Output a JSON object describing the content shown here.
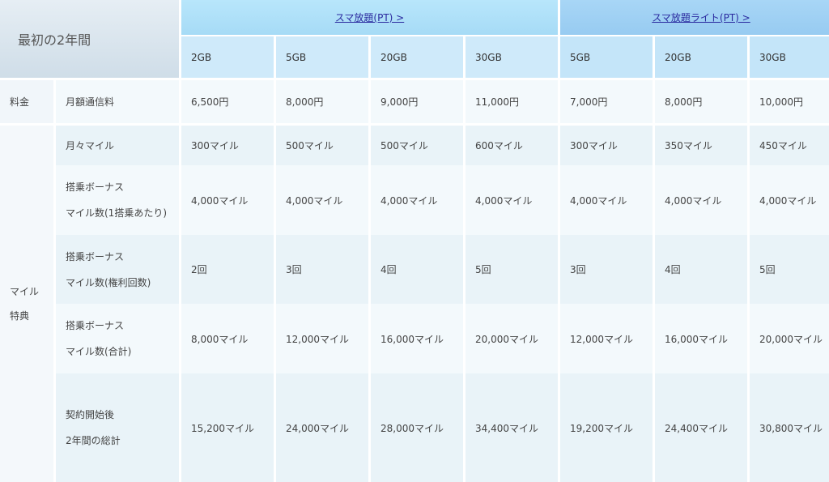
{
  "header": {
    "corner": "最初の2年間",
    "groups": [
      {
        "label": "スマ放題(PT) >"
      },
      {
        "label": "スマ放題ライト(PT) >"
      }
    ],
    "plans": [
      "2GB",
      "5GB",
      "20GB",
      "30GB",
      "5GB",
      "20GB",
      "30GB"
    ]
  },
  "sections": [
    {
      "label": "料金"
    },
    {
      "label": "マイル\n特典"
    }
  ],
  "rows": [
    {
      "label": "月額通信料",
      "values": [
        "6,500円",
        "8,000円",
        "9,000円",
        "11,000円",
        "7,000円",
        "8,000円",
        "10,000円"
      ]
    },
    {
      "label": "月々マイル",
      "values": [
        "300マイル",
        "500マイル",
        "500マイル",
        "600マイル",
        "300マイル",
        "350マイル",
        "450マイル"
      ]
    },
    {
      "label": "搭乗ボーナス\nマイル数(1搭乗あたり)",
      "values": [
        "4,000マイル",
        "4,000マイル",
        "4,000マイル",
        "4,000マイル",
        "4,000マイル",
        "4,000マイル",
        "4,000マイル"
      ]
    },
    {
      "label": "搭乗ボーナス\nマイル数(権利回数)",
      "values": [
        "2回",
        "3回",
        "4回",
        "5回",
        "3回",
        "4回",
        "5回"
      ]
    },
    {
      "label": "搭乗ボーナス\nマイル数(合計)",
      "values": [
        "8,000マイル",
        "12,000マイル",
        "16,000マイル",
        "20,000マイル",
        "12,000マイル",
        "16,000マイル",
        "20,000マイル"
      ]
    },
    {
      "label": "契約開始後\n2年間の総計",
      "values": [
        "15,200マイル",
        "24,000マイル",
        "28,000マイル",
        "34,400マイル",
        "19,200マイル",
        "24,400マイル",
        "30,800マイル"
      ]
    }
  ]
}
